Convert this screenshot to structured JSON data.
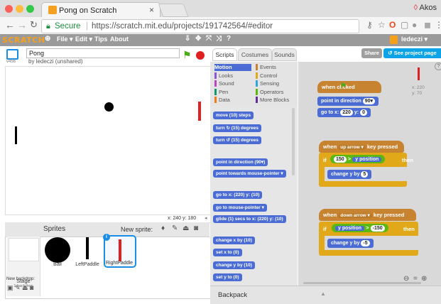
{
  "browser": {
    "tab_title": "Pong on Scratch",
    "tab_close": "×",
    "user_name": "Akos",
    "url_secure_label": "Secure",
    "url": "https://scratch.mit.edu/projects/191742564/#editor"
  },
  "menubar": {
    "logo": "SCRATCH",
    "items": [
      "File ▾",
      "Edit ▾",
      "Tips",
      "About"
    ],
    "user": "ledeczi ▾"
  },
  "project": {
    "title": "Pong",
    "owner": "by ledeczi (unshared)",
    "version": "v456",
    "coords": "x: 240  y: 180"
  },
  "editor_tabs": [
    "Scripts",
    "Costumes",
    "Sounds"
  ],
  "buttons": {
    "share": "Share",
    "see_project_page": "See project page"
  },
  "categories": [
    {
      "left": "Motion",
      "right": "Events",
      "lc": "#4a6cd4",
      "rc": "#c88330"
    },
    {
      "left": "Looks",
      "right": "Control",
      "lc": "#8a55d7",
      "rc": "#e1a91a"
    },
    {
      "left": "Sound",
      "right": "Sensing",
      "lc": "#bb42c3",
      "rc": "#2ca5e2"
    },
    {
      "left": "Pen",
      "right": "Operators",
      "lc": "#0e9a6c",
      "rc": "#5cb712"
    },
    {
      "left": "Data",
      "right": "More Blocks",
      "lc": "#ee7d16",
      "rc": "#632d99"
    }
  ],
  "palette_blocks": [
    "move (10) steps",
    "turn ↻ (15) degrees",
    "turn ↺ (15) degrees",
    "point in direction (90▾)",
    "point towards mouse-pointer ▾",
    "go to x: (220) y: (10)",
    "go to mouse-pointer ▾",
    "glide (1) secs to x: (220) y: (10)",
    "change x by (10)",
    "set x to (0)",
    "change y by (10)",
    "set y to (0)"
  ],
  "sprites_pane": {
    "header": "Sprites",
    "new_sprite": "New sprite:",
    "stage_label": "Stage",
    "stage_sub": "1 backdrop",
    "new_backdrop": "New backdrop:",
    "sprites": [
      "Ball",
      "LeftPaddle",
      "RightPaddle"
    ]
  },
  "script_area": {
    "sprite_xy": [
      "x: 220",
      "y: 70"
    ],
    "script1": {
      "hat": "when  clicked",
      "b1": "point in direction",
      "b1v": "90▾",
      "b2": "go to x:",
      "b2x": "220",
      "b2y_label": "y:",
      "b2y": "0"
    },
    "script2": {
      "hat_pre": "when",
      "key": "up arrow ▾",
      "hat_post": "key pressed",
      "if": "if",
      "num": "150",
      "op": ">",
      "reporter": "y position",
      "then": "then",
      "change": "change y by",
      "change_v": "5"
    },
    "script3": {
      "hat_pre": "when",
      "key": "down arrow ▾",
      "hat_post": "key pressed",
      "if": "if",
      "reporter": "y position",
      "op": ">",
      "num": "-150",
      "then": "then",
      "change": "change y by",
      "change_v": "-5"
    }
  },
  "backpack": "Backpack",
  "colors": {
    "motion": "#4a6cd4",
    "events": "#c88330",
    "control": "#e1a91a",
    "operators": "#5cb712",
    "paddle_right": "#e02020"
  }
}
